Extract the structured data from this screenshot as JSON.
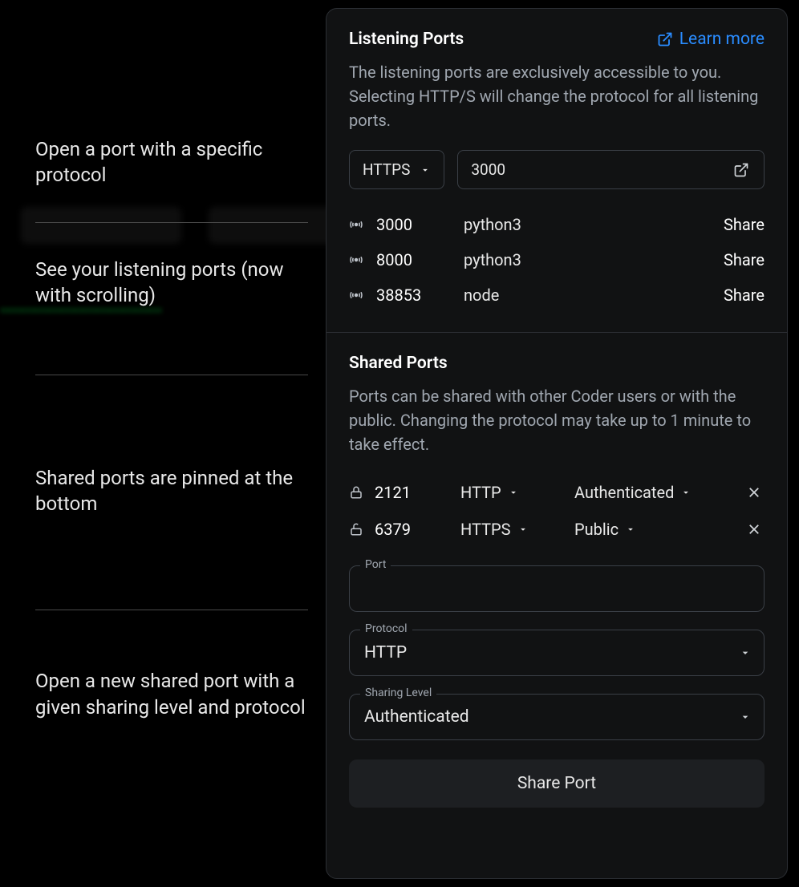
{
  "annotations": {
    "a1": "Open a port with a specific protocol",
    "a2": "See your listening ports (now with scrolling)",
    "a3": "Shared ports are pinned at the bottom",
    "a4": "Open a new shared port with a given sharing level and protocol"
  },
  "listening": {
    "title": "Listening Ports",
    "learn_more": "Learn more",
    "description": "The listening ports are exclusively accessible to you. Selecting HTTP/S will change the protocol for all listening ports.",
    "protocol": "HTTPS",
    "port_value": "3000",
    "ports": [
      {
        "port": "3000",
        "process": "python3",
        "action": "Share"
      },
      {
        "port": "8000",
        "process": "python3",
        "action": "Share"
      },
      {
        "port": "38853",
        "process": "node",
        "action": "Share"
      }
    ]
  },
  "shared": {
    "title": "Shared Ports",
    "description": "Ports can be shared with other Coder users or with the public. Changing the protocol may take up to 1 minute to take effect.",
    "rows": [
      {
        "port": "2121",
        "protocol": "HTTP",
        "level": "Authenticated",
        "lock": "locked"
      },
      {
        "port": "6379",
        "protocol": "HTTPS",
        "level": "Public",
        "lock": "unlocked"
      }
    ],
    "form": {
      "port_label": "Port",
      "protocol_label": "Protocol",
      "protocol_value": "HTTP",
      "level_label": "Sharing Level",
      "level_value": "Authenticated",
      "submit": "Share Port"
    }
  }
}
